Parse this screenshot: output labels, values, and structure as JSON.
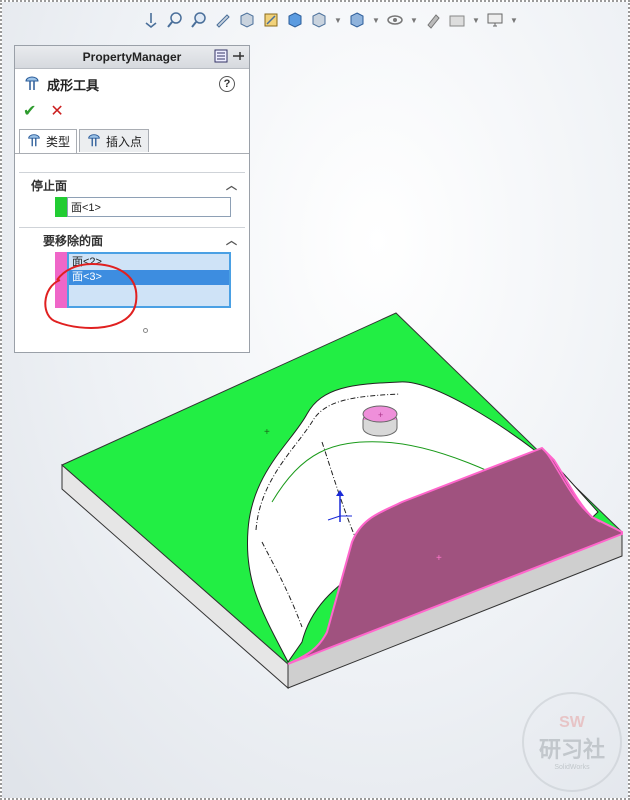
{
  "heads_up_toolbar": {
    "icons": [
      "view-orientation-icon",
      "zoom-to-fit-icon",
      "zoom-to-area-icon",
      "previous-view-icon",
      "section-view-icon",
      "dynamic-annotation-icon",
      "3d-box-icon",
      "view-settings-icon",
      "display-style-icon",
      "hide-show-icon",
      "edit-appearance-icon",
      "apply-scene-icon",
      "monitor-icon"
    ]
  },
  "property_manager": {
    "header_title": "PropertyManager",
    "feature_title": "成形工具",
    "help_symbol": "?",
    "ok_symbol": "✔",
    "cancel_symbol": "✕",
    "tabs": [
      {
        "label": "类型",
        "active": true
      },
      {
        "label": "插入点",
        "active": false
      }
    ],
    "stop_face": {
      "title": "停止面",
      "value": "面<1>",
      "swatch_color": "#22cc33"
    },
    "faces_to_remove": {
      "title": "要移除的面",
      "items": [
        {
          "label": "面<2>",
          "selected": false
        },
        {
          "label": "面<3>",
          "selected": true
        }
      ],
      "swatch_color": "#ef66c8"
    }
  },
  "colors": {
    "stop_face_green": "#22ee44",
    "remove_face_pink": "#a0527f",
    "highlight_edge": "#ff66cc",
    "annotation_red": "#e02020",
    "list_selection": "#3d8de0"
  },
  "watermark": {
    "top_text": "SW",
    "main_text": "研习社",
    "sub_text": "SolidWorks"
  }
}
